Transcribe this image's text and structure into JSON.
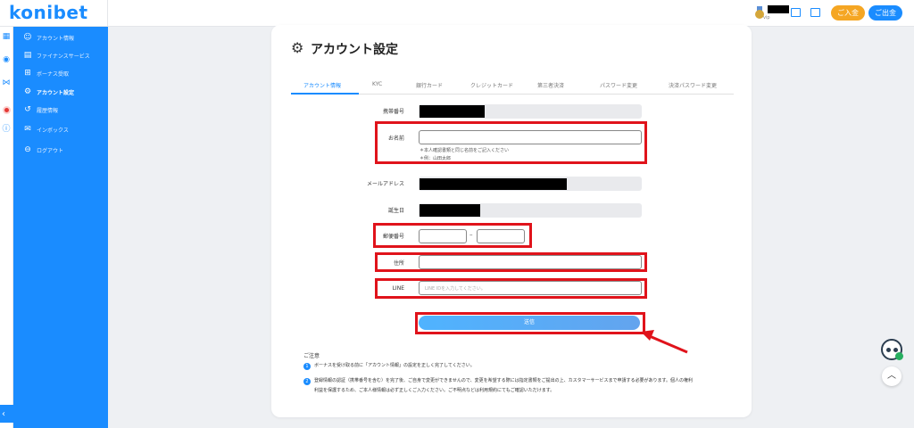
{
  "header": {
    "logo": "konibet",
    "vip_label": "vip",
    "deposit_button": "ご入金",
    "withdraw_button": "ご出金"
  },
  "sidebar": {
    "items": [
      {
        "label": "アカウント情報",
        "icon": "user-icon"
      },
      {
        "label": "ファイナンスサービス",
        "icon": "finance-icon"
      },
      {
        "label": "ボーナス受取",
        "icon": "gift-icon"
      },
      {
        "label": "アカウント設定",
        "icon": "gear-icon",
        "active": true
      },
      {
        "label": "履歴情報",
        "icon": "history-icon"
      },
      {
        "label": "インボックス",
        "icon": "inbox-icon"
      },
      {
        "label": "ログアウト",
        "icon": "logout-icon"
      }
    ],
    "collapse_icon": "‹"
  },
  "card": {
    "title": "アカウント設定",
    "tabs": [
      "アカウント情報",
      "KYC",
      "銀行カード",
      "クレジットカード",
      "第三者決済",
      "パスワード変更",
      "決済パスワード変更"
    ],
    "active_tab": 0,
    "fields": {
      "phone_label": "携帯番号",
      "name_label": "お名前",
      "name_hint_1": "＊本人確認書類と同じ名前をご記入ください",
      "name_hint_2": "＊例：山田太郎",
      "email_label": "メールアドレス",
      "birth_label": "誕生日",
      "postal_label": "郵便番号",
      "postal_separator": "–",
      "address_label": "住所",
      "line_label": "LINE",
      "line_placeholder": "LINE IDを入力してください。"
    },
    "submit_label": "送信",
    "notes_title": "ご注意",
    "notes": [
      {
        "num": "1",
        "text": "ボーナスを受け取る前に「アカウント情報」の設定を正しく完了してください。"
      },
      {
        "num": "2",
        "text_line1": "登録情報の認証（携帯番号を含む）を完了後、ご自身で変更ができませんので、変更を希望する際には指定書類をご提出の上、カスタマーサービスまで申請する必要があります。個人の権利",
        "text_line2": "利益を保護するため、ご本人様情報は必ず正しくご入力ください。ご不明点などは利用規約にてもご確認いただけます。"
      }
    ]
  },
  "colors": {
    "brand_blue": "#1a8cff",
    "deposit_orange": "#f5a623",
    "highlight_red": "#e0131b"
  }
}
